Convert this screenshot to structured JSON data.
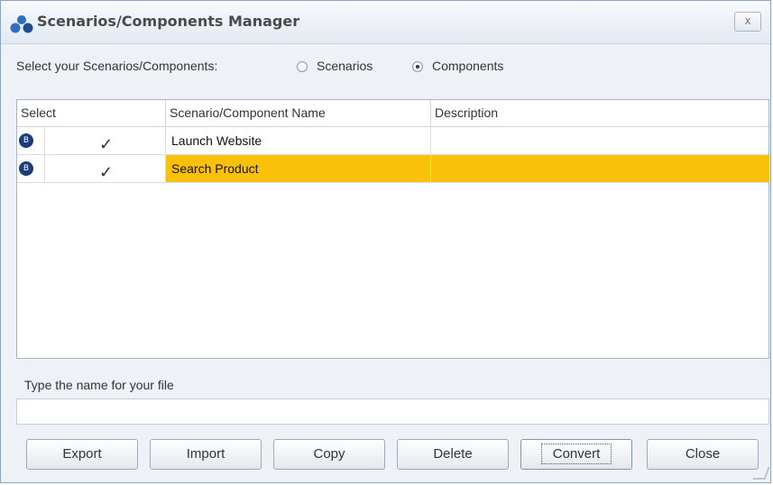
{
  "window": {
    "title": "Scenarios/Components Manager",
    "close_label": "x"
  },
  "selector": {
    "label": "Select your Scenarios/Components:",
    "options": [
      {
        "label": "Scenarios",
        "selected": false
      },
      {
        "label": "Components",
        "selected": true
      }
    ]
  },
  "grid": {
    "columns": [
      "Select",
      "Scenario/Component Name",
      "Description"
    ],
    "rows": [
      {
        "icon": "component-icon",
        "checked": true,
        "name": "Launch Website",
        "description": "",
        "selected": false
      },
      {
        "icon": "component-icon",
        "checked": true,
        "name": "Search Product",
        "description": "",
        "selected": true
      }
    ],
    "highlight_color": "#fac10a"
  },
  "file": {
    "label": "Type the name for your file",
    "value": ""
  },
  "buttons": {
    "export": "Export",
    "import": "Import",
    "copy": "Copy",
    "delete": "Delete",
    "convert": "Convert",
    "close": "Close"
  }
}
